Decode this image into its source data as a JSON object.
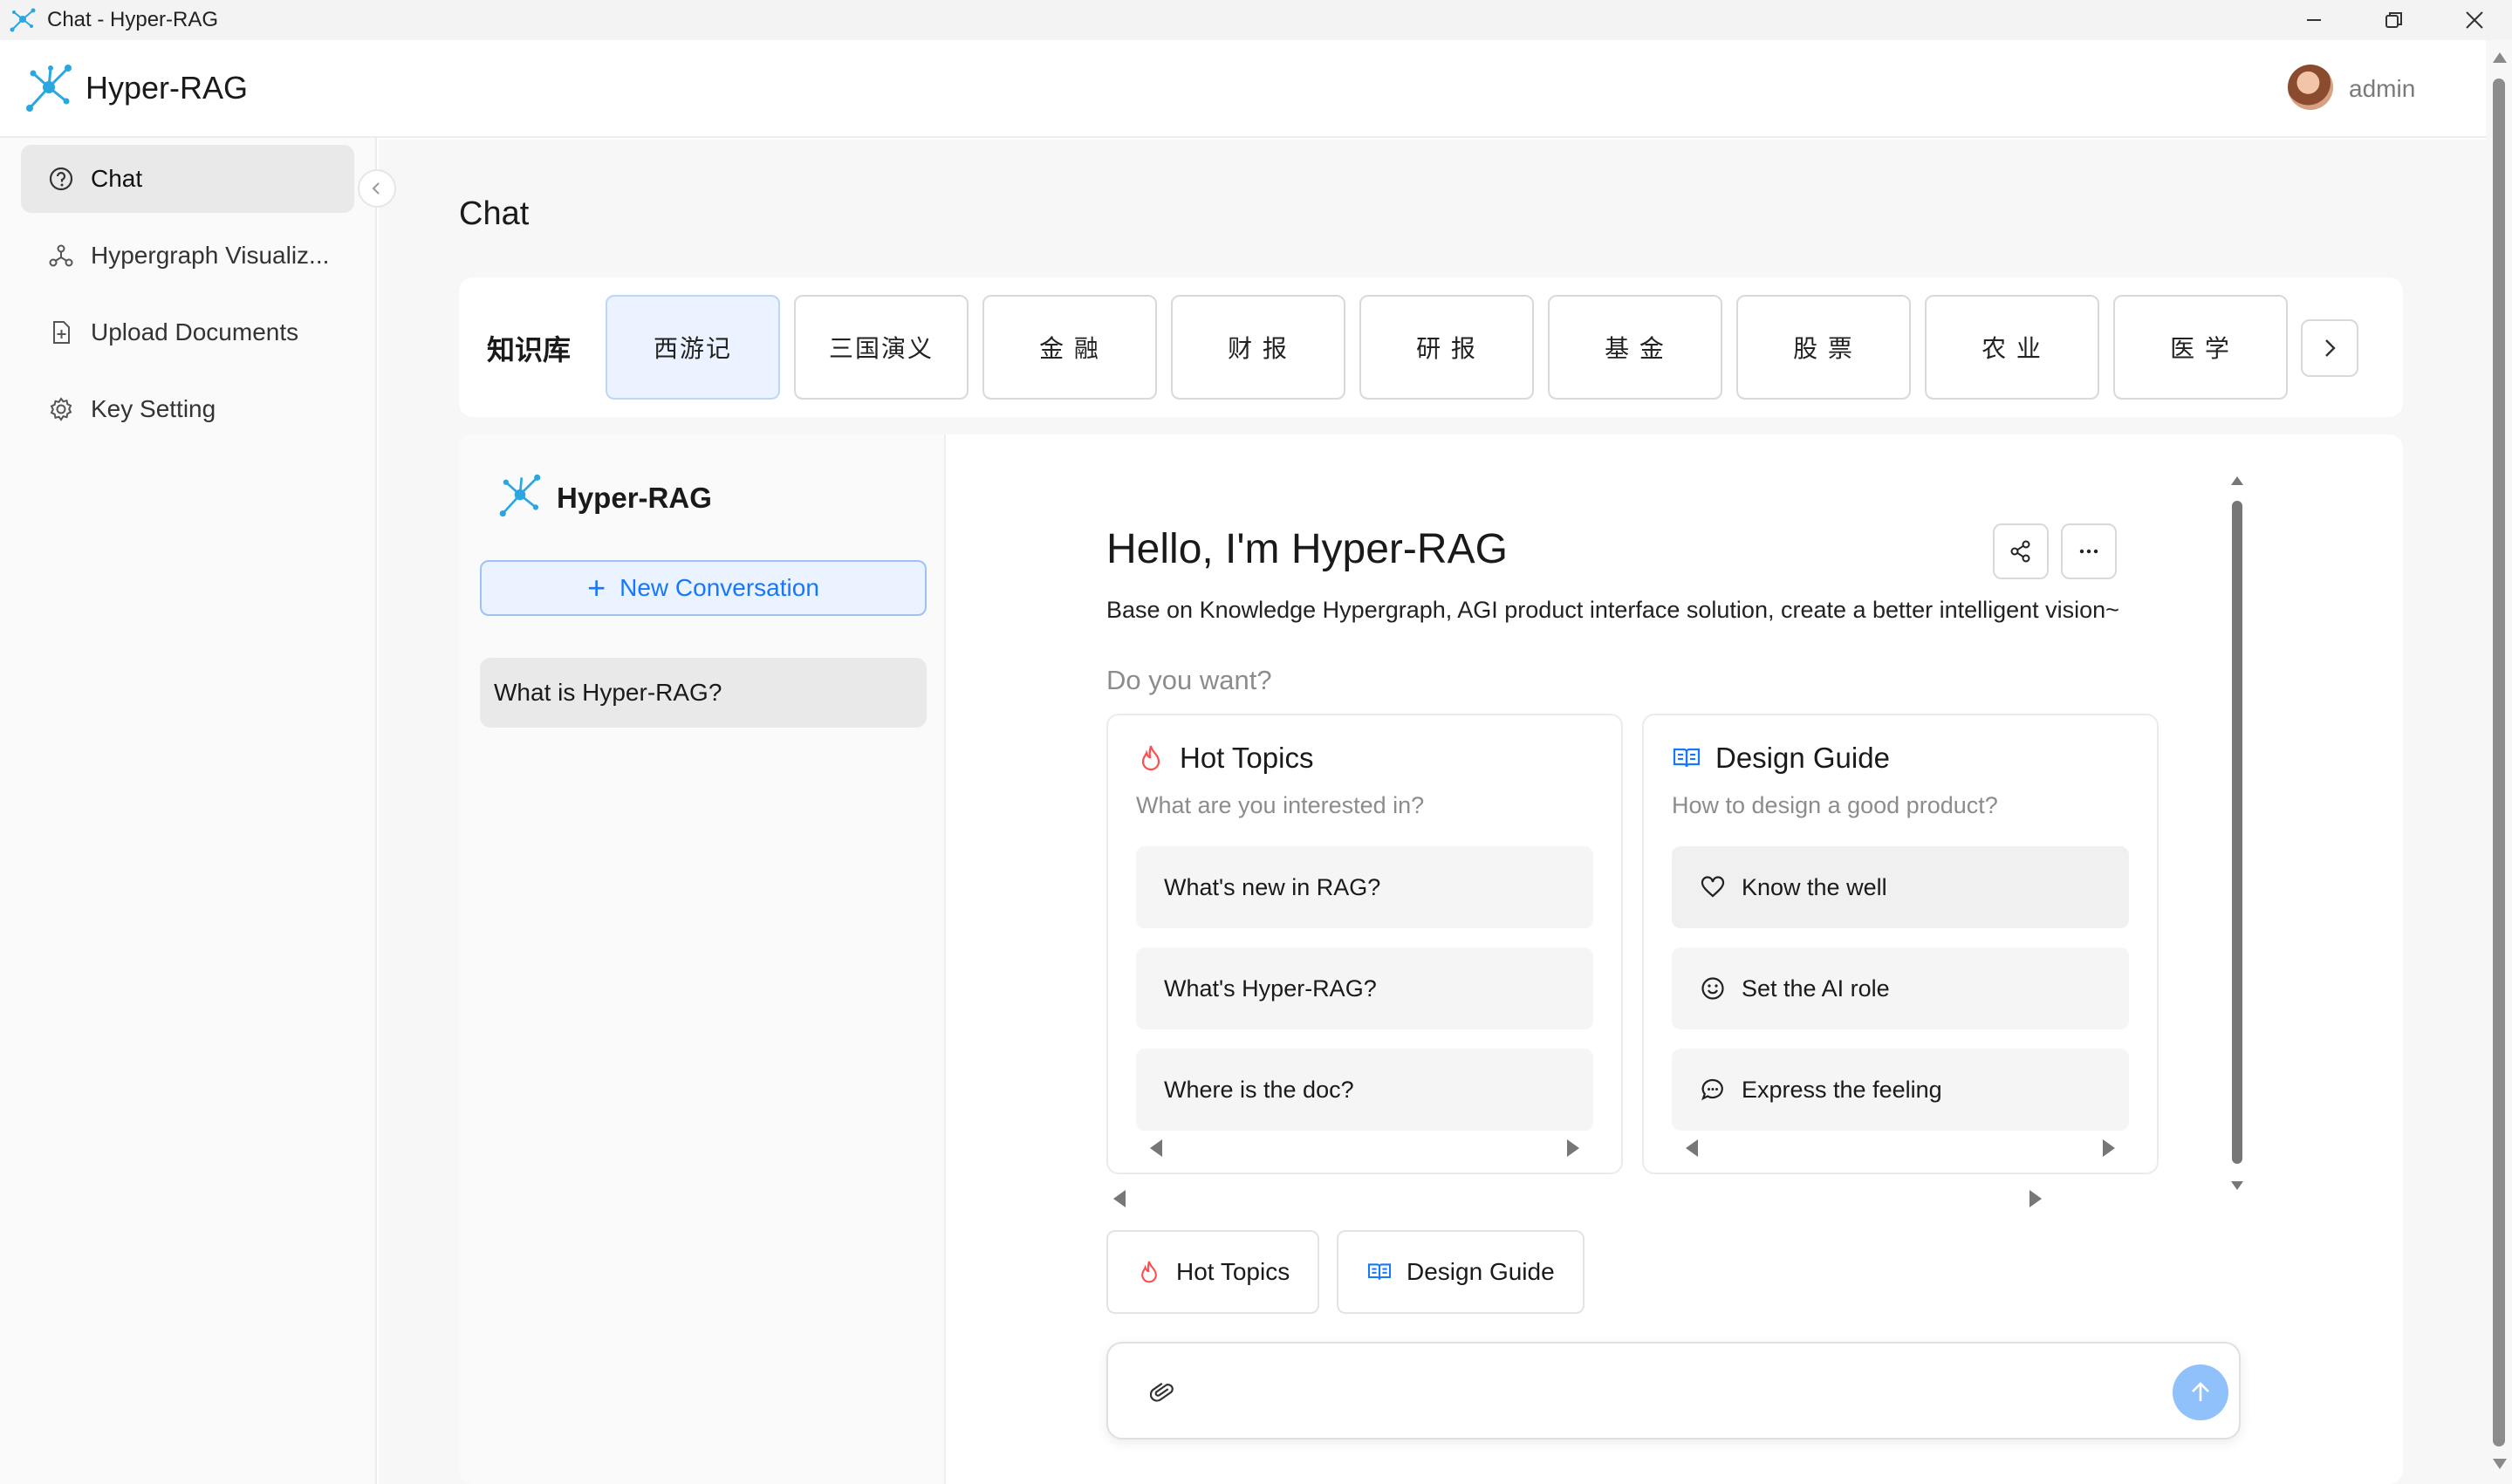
{
  "window": {
    "title": "Chat - Hyper-RAG"
  },
  "header": {
    "brand": "Hyper-RAG",
    "user_name": "admin"
  },
  "sidebar": {
    "items": [
      {
        "label": "Chat",
        "icon": "question-circle-icon",
        "active": true
      },
      {
        "label": "Hypergraph Visualiz...",
        "icon": "nodes-icon",
        "active": false
      },
      {
        "label": "Upload Documents",
        "icon": "file-add-icon",
        "active": false
      },
      {
        "label": "Key Setting",
        "icon": "gear-icon",
        "active": false
      }
    ]
  },
  "page": {
    "title": "Chat"
  },
  "knowledge_base": {
    "label": "知识库",
    "tabs": [
      "西游记",
      "三国演义",
      "金 融",
      "财 报",
      "研 报",
      "基 金",
      "股 票",
      "农 业",
      "医 学"
    ],
    "selected": "西游记"
  },
  "conversations": {
    "brand": "Hyper-RAG",
    "new_button": "New Conversation",
    "items": [
      "What is Hyper-RAG?"
    ]
  },
  "welcome": {
    "title": "Hello, I'm Hyper-RAG",
    "description": "Base on Knowledge Hypergraph, AGI product interface solution, create a better intelligent vision~",
    "prompt_heading": "Do you want?"
  },
  "prompt_groups": [
    {
      "title": "Hot Topics",
      "subtitle": "What are you interested in?",
      "icon": "fire-icon",
      "items": [
        {
          "label": "What's new in RAG?"
        },
        {
          "label": "What's Hyper-RAG?"
        },
        {
          "label": "Where is the doc?"
        }
      ]
    },
    {
      "title": "Design Guide",
      "subtitle": "How to design a good product?",
      "icon": "book-icon",
      "items": [
        {
          "label": "Know the well",
          "icon": "heart-icon"
        },
        {
          "label": "Set the AI role",
          "icon": "smile-icon"
        },
        {
          "label": "Express the feeling",
          "icon": "comment-icon"
        }
      ]
    }
  ],
  "chips": [
    {
      "label": "Hot Topics",
      "icon": "fire-icon"
    },
    {
      "label": "Design Guide",
      "icon": "book-icon"
    }
  ],
  "composer": {
    "value": "",
    "placeholder": ""
  },
  "colors": {
    "accent": "#1677ff",
    "fire": "#ff4d4f",
    "send": "#91c1fb",
    "selected_tab": "#eaf3ff"
  }
}
